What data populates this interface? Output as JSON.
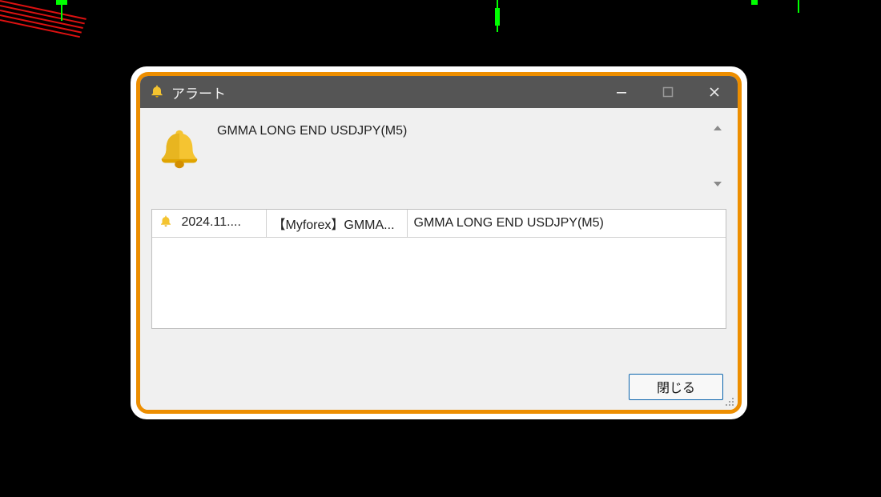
{
  "window": {
    "title": "アラート",
    "controls": {
      "min": "minimize",
      "max": "maximize",
      "close": "close"
    }
  },
  "alert": {
    "icon": "bell-icon",
    "message": "GMMA LONG END USDJPY(M5)"
  },
  "scroll": {
    "up_icon": "chevron-up-icon",
    "down_icon": "chevron-down-icon"
  },
  "table": {
    "rows": [
      {
        "icon": "bell-icon",
        "time": "2024.11....",
        "source": "【Myforex】GMMA...",
        "text": "GMMA LONG END USDJPY(M5)"
      }
    ]
  },
  "footer": {
    "close_label": "閉じる"
  },
  "colors": {
    "accent": "#ed8e00",
    "titlebar": "#555555",
    "button_border": "#0a64ad"
  }
}
